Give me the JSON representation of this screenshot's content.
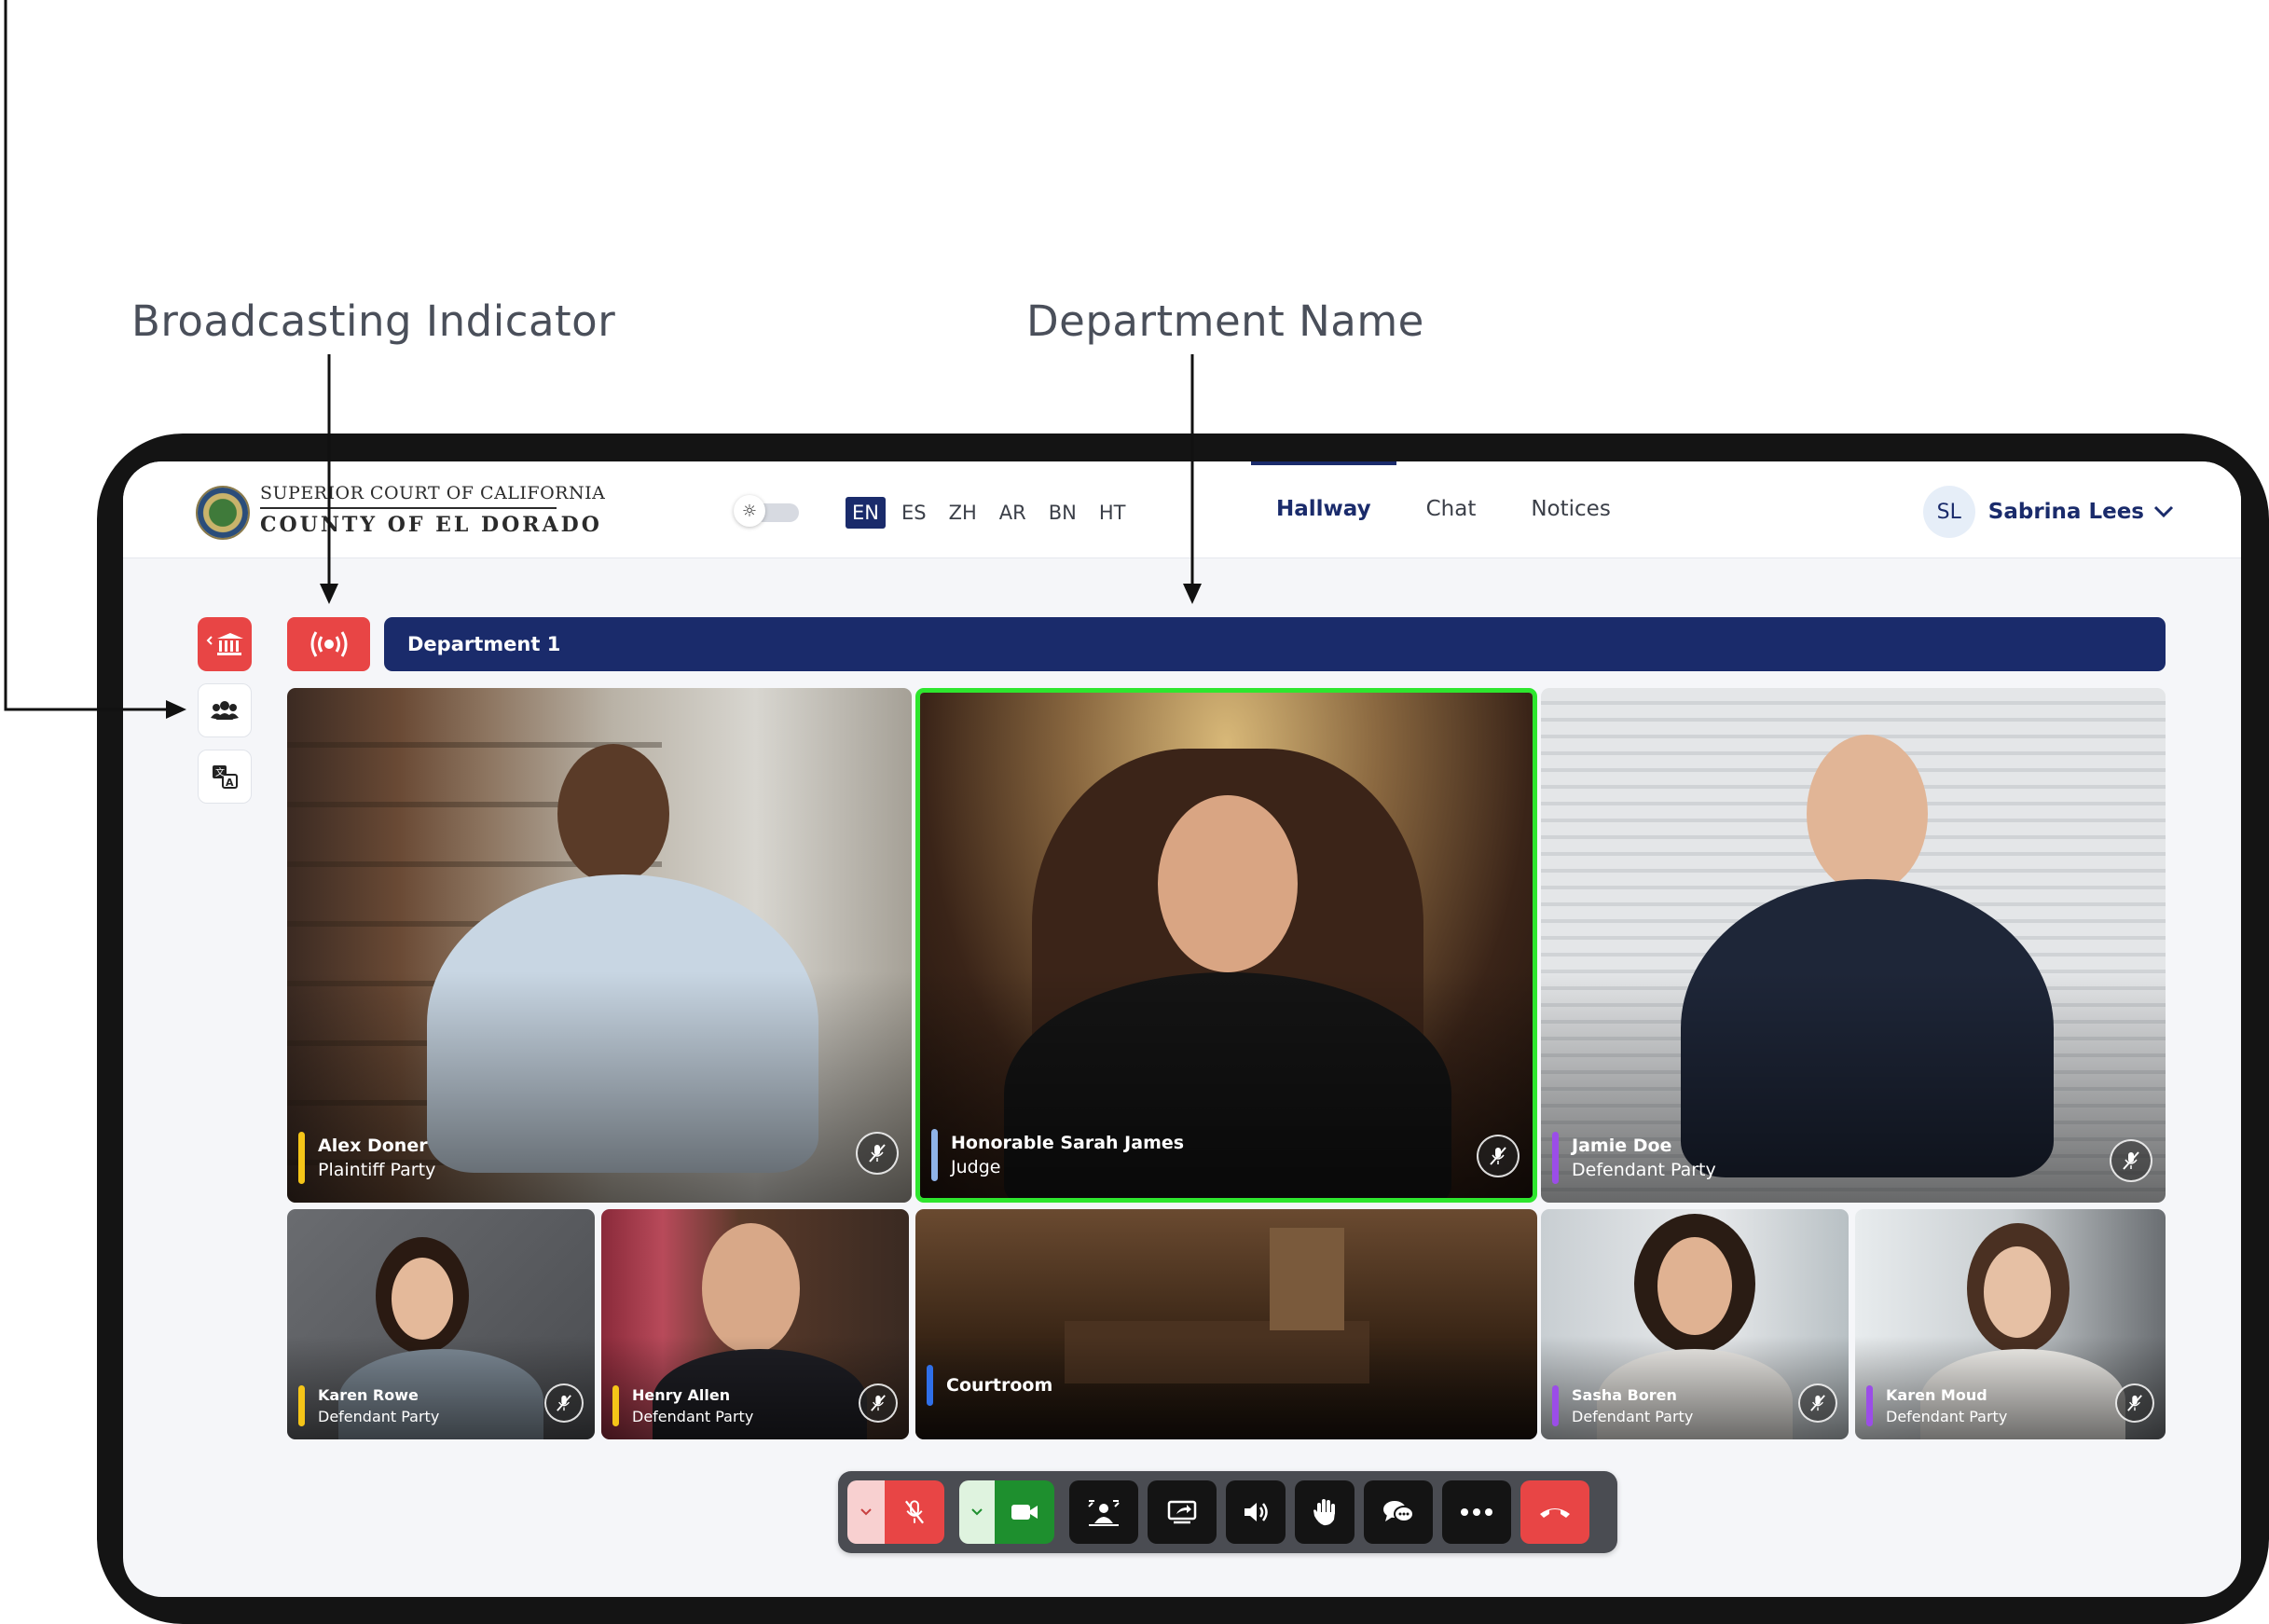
{
  "annotations": {
    "broadcasting_indicator": "Broadcasting Indicator",
    "department_name": "Department Name"
  },
  "header": {
    "logo_line1": "SUPERIOR COURT OF CALIFORNIA",
    "logo_line2": "COUNTY OF EL DORADO",
    "languages": [
      "EN",
      "ES",
      "ZH",
      "AR",
      "BN",
      "HT"
    ],
    "active_language": "EN",
    "tabs": [
      {
        "label": "Hallway",
        "active": true
      },
      {
        "label": "Chat",
        "active": false
      },
      {
        "label": "Notices",
        "active": false
      }
    ],
    "user": {
      "initials": "SL",
      "name": "Sabrina Lees"
    }
  },
  "sidebar": {
    "buttons": [
      {
        "icon": "courthouse-back-icon"
      },
      {
        "icon": "participants-icon"
      },
      {
        "icon": "translate-icon"
      }
    ]
  },
  "department": {
    "name": "Department 1"
  },
  "participants": [
    {
      "name": "Alex Doner",
      "role": "Plaintiff Party",
      "stripe_color": "#f5c518",
      "muted": true
    },
    {
      "name": "Honorable Sarah James",
      "role": "Judge",
      "stripe_color": "#8fb3e8",
      "muted": true,
      "active_speaker": true
    },
    {
      "name": "Jamie Doe",
      "role": "Defendant Party",
      "stripe_color": "#9b4de8",
      "muted": true
    },
    {
      "name": "Karen Rowe",
      "role": "Defendant Party",
      "stripe_color": "#f5c518",
      "muted": true
    },
    {
      "name": "Henry Allen",
      "role": "Defendant Party",
      "stripe_color": "#f5c518",
      "muted": true
    },
    {
      "name": "Courtroom",
      "role": "",
      "stripe_color": "#2f6fe8",
      "muted": false
    },
    {
      "name": "Sasha Boren",
      "role": "Defendant Party",
      "stripe_color": "#9b4de8",
      "muted": true
    },
    {
      "name": "Karen Moud",
      "role": "Defendant Party",
      "stripe_color": "#9b4de8",
      "muted": true
    }
  ],
  "controls": [
    "mic-options-chevron",
    "mic-muted-icon",
    "camera-options-chevron",
    "camera-on-icon",
    "background-blur-icon",
    "share-screen-icon",
    "speaker-volume-icon",
    "raise-hand-icon",
    "chat-bubbles-icon",
    "more-options-icon",
    "end-call-icon"
  ],
  "colors": {
    "brand_navy": "#1a2b6b",
    "alert_red": "#e84545",
    "active_speaker_green": "#2ee62e",
    "camera_green": "#1e8f2e"
  }
}
